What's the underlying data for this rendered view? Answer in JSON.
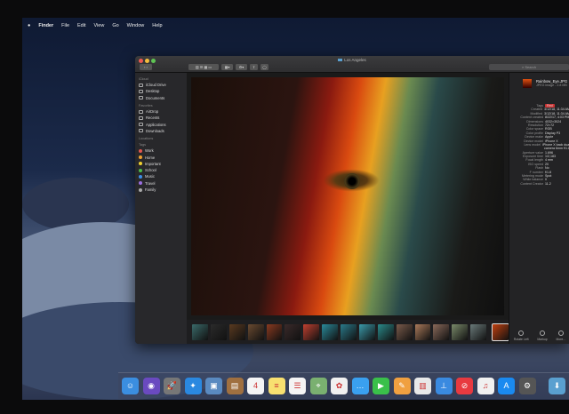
{
  "menubar": {
    "items": [
      "Finder",
      "File",
      "Edit",
      "View",
      "Go",
      "Window",
      "Help"
    ]
  },
  "window": {
    "title": "Los Angeles",
    "search_placeholder": "Search"
  },
  "sidebar": {
    "sections": [
      {
        "header": "iCloud",
        "items": [
          "iCloud Drive",
          "Desktop",
          "Documents"
        ]
      },
      {
        "header": "Favorites",
        "items": [
          "AirDrop",
          "Recents",
          "Applications",
          "Downloads"
        ]
      },
      {
        "header": "Locations",
        "items": []
      },
      {
        "header": "Tags",
        "items": [
          "Work",
          "Home",
          "Important",
          "School",
          "Music",
          "Travel",
          "Family"
        ]
      }
    ],
    "tag_colors": [
      "#e0554f",
      "#f0a030",
      "#f0d030",
      "#4cbb4c",
      "#3d8ee8",
      "#9a6ee0",
      "#aaaaaa"
    ]
  },
  "inspector": {
    "file_name": "Rainbow_Eye.JPG",
    "file_info": "JPEG image - 2.8 MB",
    "rows": [
      {
        "k": "Tags",
        "v": "Red"
      },
      {
        "k": "Created",
        "v": "3/12/18, 11:34 AM"
      },
      {
        "k": "Modified",
        "v": "3/12/18, 11:34 AM"
      },
      {
        "k": "Content created",
        "v": "8/22/17, 4:03 PM"
      },
      {
        "k": "Dimensions",
        "v": "4032×3024"
      },
      {
        "k": "Resolution",
        "v": "72×72"
      },
      {
        "k": "Color space",
        "v": "RGB"
      },
      {
        "k": "Color profile",
        "v": "Display P3"
      },
      {
        "k": "Device make",
        "v": "Apple"
      },
      {
        "k": "Device model",
        "v": "iPhone X"
      },
      {
        "k": "Lens model",
        "v": "iPhone X back dual"
      },
      {
        "k": "",
        "v": "camera 6mm f/1.8"
      },
      {
        "k": "Aperture value",
        "v": "1.696"
      },
      {
        "k": "Exposure time",
        "v": "1/2,183"
      },
      {
        "k": "Focal length",
        "v": "4 mm"
      },
      {
        "k": "ISO speed",
        "v": "20"
      },
      {
        "k": "Flash",
        "v": "No"
      },
      {
        "k": "F number",
        "v": "f/1.8"
      },
      {
        "k": "Metering mode",
        "v": "Spot"
      },
      {
        "k": "White balance",
        "v": "0"
      },
      {
        "k": "Content Creator",
        "v": "11.2"
      }
    ],
    "actions": [
      "Rotate Left",
      "Markup",
      "More..."
    ]
  },
  "thumbnail_colors": [
    "#3a6a6a",
    "#2b2b2b",
    "#5a3a20",
    "#6a4a30",
    "#8a3a20",
    "#3a2a2a",
    "#c04030",
    "#2a8a9a",
    "#2a7a8a",
    "#3a9aaa",
    "#2a8a8a",
    "#7a5a4a",
    "#aa7a5a",
    "#8a6a5a",
    "#7a8a6a",
    "#6a7a7a",
    "#c04010"
  ],
  "dock": {
    "apps": [
      {
        "name": "finder",
        "color": "#3b8ee0",
        "g": "☺"
      },
      {
        "name": "siri",
        "color": "#6a4ac0",
        "g": "◉"
      },
      {
        "name": "launchpad",
        "color": "#777",
        "g": "🚀"
      },
      {
        "name": "safari",
        "color": "#2a88e0",
        "g": "✦"
      },
      {
        "name": "preview",
        "color": "#5a8ac0",
        "g": "▣"
      },
      {
        "name": "contacts",
        "color": "#a07040",
        "g": "▤"
      },
      {
        "name": "calendar",
        "color": "#f4f4f4",
        "g": "4"
      },
      {
        "name": "notes",
        "color": "#f8e070",
        "g": "≡"
      },
      {
        "name": "reminders",
        "color": "#f4f4f4",
        "g": "☰"
      },
      {
        "name": "maps",
        "color": "#7ab070",
        "g": "⌖"
      },
      {
        "name": "photos",
        "color": "#f0f0f0",
        "g": "✿"
      },
      {
        "name": "messages",
        "color": "#3aa0f0",
        "g": "…"
      },
      {
        "name": "facetime",
        "color": "#3ac04a",
        "g": "▶"
      },
      {
        "name": "pages",
        "color": "#f0a040",
        "g": "✎"
      },
      {
        "name": "numbers",
        "color": "#e8e8e8",
        "g": "▥"
      },
      {
        "name": "keynote",
        "color": "#3a8ae0",
        "g": "⊥"
      },
      {
        "name": "news",
        "color": "#e83a40",
        "g": "⊘"
      },
      {
        "name": "music",
        "color": "#f0f0f0",
        "g": "♫"
      },
      {
        "name": "app-store",
        "color": "#1a8af0",
        "g": "A"
      },
      {
        "name": "system-preferences",
        "color": "#555",
        "g": "⚙"
      },
      {
        "name": "downloads-folder",
        "color": "#5aa0d0",
        "g": "⬇"
      }
    ]
  }
}
